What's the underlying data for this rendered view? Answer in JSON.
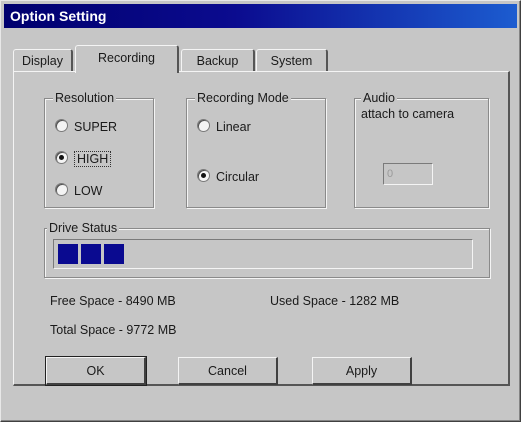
{
  "window": {
    "title": "Option Setting"
  },
  "tabs": [
    {
      "label": "Display",
      "active": false
    },
    {
      "label": "Recording",
      "active": true
    },
    {
      "label": "Backup",
      "active": false
    },
    {
      "label": "System",
      "active": false
    }
  ],
  "resolution": {
    "legend": "Resolution",
    "options": [
      {
        "label": "SUPER",
        "checked": false
      },
      {
        "label": "HIGH",
        "checked": true
      },
      {
        "label": "LOW",
        "checked": false
      }
    ]
  },
  "recording_mode": {
    "legend": "Recording Mode",
    "options": [
      {
        "label": "Linear",
        "checked": false
      },
      {
        "label": "Circular",
        "checked": true
      }
    ]
  },
  "audio": {
    "legend": "Audio",
    "caption": "attach to camera",
    "value": "0"
  },
  "drive_status": {
    "legend": "Drive Status",
    "used_fraction": 0.13
  },
  "space": {
    "free": "Free Space - 8490 MB",
    "used": "Used Space - 1282 MB",
    "total": "Total Space - 9772 MB"
  },
  "buttons": {
    "ok": "OK",
    "cancel": "Cancel",
    "apply": "Apply"
  },
  "colors": {
    "title_start": "#00006e",
    "title_end": "#1c5cd0",
    "progress": "#0a0a90",
    "face": "#c6c6c6"
  }
}
